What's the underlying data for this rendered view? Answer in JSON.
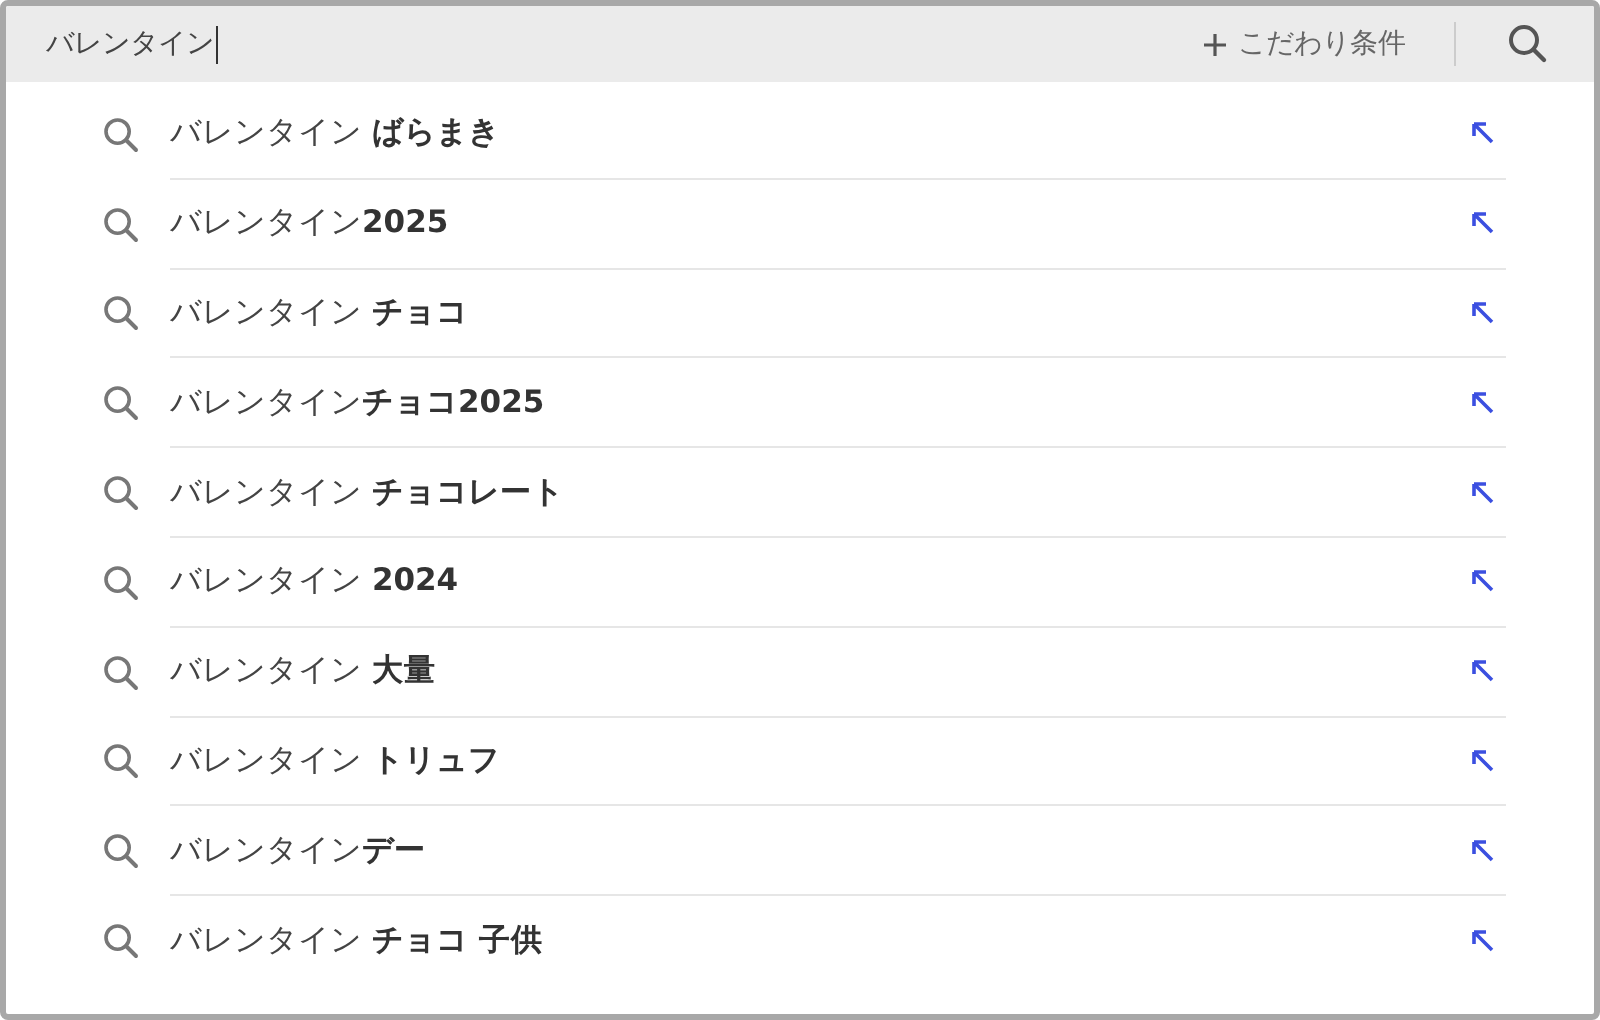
{
  "search": {
    "value": "バレンタイン",
    "filter_label": "こだわり条件"
  },
  "suggestions": [
    {
      "text": "バレンタイン **ばらまき**"
    },
    {
      "text": "バレンタイン**2025**"
    },
    {
      "text": "バレンタイン **チョコ**"
    },
    {
      "text": "バレンタイン**チョコ2025**"
    },
    {
      "text": "バレンタイン **チョコレート**"
    },
    {
      "text": "バレンタイン **2024**"
    },
    {
      "text": "バレンタイン **大量**"
    },
    {
      "text": "バレンタイン **トリュフ**"
    },
    {
      "text": "バレンタイン**デー**"
    },
    {
      "text": "バレンタイン **チョコ 子供**"
    }
  ]
}
